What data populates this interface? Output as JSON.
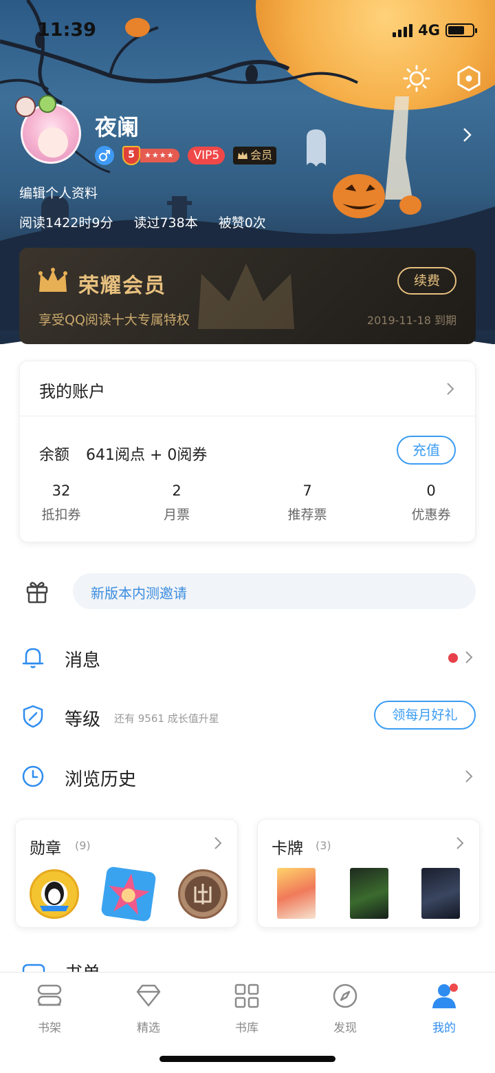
{
  "status_bar": {
    "time": "11:39",
    "network": "4G",
    "battery_level": 0.68
  },
  "profile": {
    "username": "夜阑",
    "level": "5",
    "level_stars": "★★★★",
    "vip_label": "VIP5",
    "member_label": "会员",
    "edit_label": "编辑个人资料",
    "stats": [
      "阅读1422时9分",
      "读过738本",
      "被赞0次"
    ]
  },
  "vip_card": {
    "title": "荣耀会员",
    "description": "享受QQ阅读十大专属特权",
    "expire": "2019-11-18 到期",
    "renew_label": "续费"
  },
  "account": {
    "title": "我的账户",
    "balance_label": "余额",
    "balance_value": "641阅点 + 0阅券",
    "recharge_label": "充值",
    "counters": [
      {
        "value": "32",
        "label": "抵扣券"
      },
      {
        "value": "2",
        "label": "月票"
      },
      {
        "value": "7",
        "label": "推荐票"
      },
      {
        "value": "0",
        "label": "优惠券"
      }
    ]
  },
  "invite": {
    "label": "新版本内测邀请"
  },
  "menu": {
    "messages": {
      "label": "消息"
    },
    "level": {
      "label": "等级",
      "hint": "还有 9561 成长值升星",
      "button": "领每月好礼"
    },
    "history": {
      "label": "浏览历史"
    },
    "booklist": {
      "label": "书单"
    }
  },
  "tiles": {
    "medals": {
      "title": "勋章",
      "count": "(9)",
      "items": [
        "penguin-medal",
        "star-medal",
        "bronze-medal"
      ]
    },
    "cards": {
      "title": "卡牌",
      "count": "(3)",
      "items": [
        "card-1",
        "card-2",
        "card-3"
      ]
    }
  },
  "tabs": [
    {
      "label": "书架",
      "icon": "bookshelf-icon"
    },
    {
      "label": "精选",
      "icon": "diamond-icon"
    },
    {
      "label": "书库",
      "icon": "grid-icon"
    },
    {
      "label": "发现",
      "icon": "compass-icon"
    },
    {
      "label": "我的",
      "icon": "person-icon",
      "active": true
    }
  ],
  "colors": {
    "accent": "#2e8cf0",
    "gold": "#e8c17f",
    "notify_red": "#e8404b"
  }
}
